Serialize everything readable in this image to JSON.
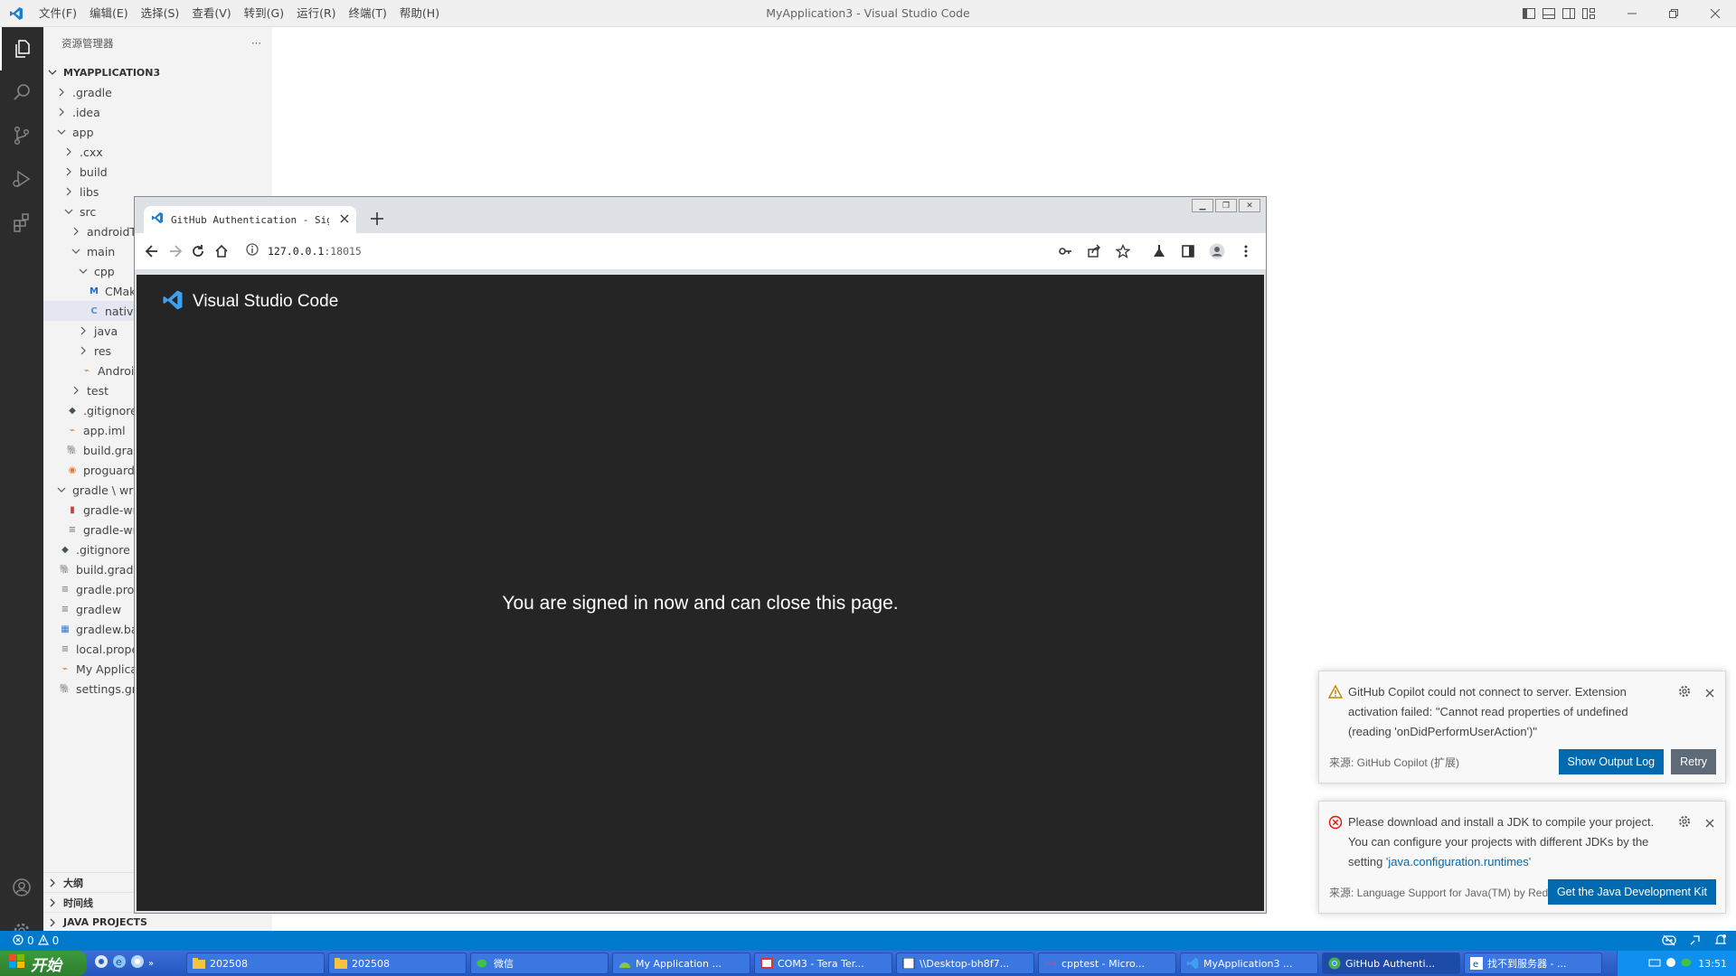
{
  "window": {
    "title": "MyApplication3 - Visual Studio Code",
    "menu": [
      "文件(F)",
      "编辑(E)",
      "选择(S)",
      "查看(V)",
      "转到(G)",
      "运行(R)",
      "终端(T)",
      "帮助(H)"
    ]
  },
  "sidebar": {
    "header": "资源管理器",
    "more_label": "···",
    "root": "MYAPPLICATION3",
    "tree": [
      {
        "label": ".gradle",
        "indent": 0,
        "kind": "folder",
        "open": false
      },
      {
        "label": ".idea",
        "indent": 0,
        "kind": "folder",
        "open": false
      },
      {
        "label": "app",
        "indent": 0,
        "kind": "folder",
        "open": true
      },
      {
        "label": ".cxx",
        "indent": 1,
        "kind": "folder",
        "open": false
      },
      {
        "label": "build",
        "indent": 1,
        "kind": "folder",
        "open": false
      },
      {
        "label": "libs",
        "indent": 1,
        "kind": "folder",
        "open": false
      },
      {
        "label": "src",
        "indent": 1,
        "kind": "folder",
        "open": true
      },
      {
        "label": "androidT",
        "indent": 2,
        "kind": "folder",
        "open": false
      },
      {
        "label": "main",
        "indent": 2,
        "kind": "folder",
        "open": true
      },
      {
        "label": "cpp",
        "indent": 3,
        "kind": "folder",
        "open": true
      },
      {
        "label": "CMak",
        "indent": 4,
        "kind": "cmake"
      },
      {
        "label": "native",
        "indent": 4,
        "kind": "cpp",
        "selected": true
      },
      {
        "label": "java",
        "indent": 3,
        "kind": "folder",
        "open": false
      },
      {
        "label": "res",
        "indent": 3,
        "kind": "folder",
        "open": false
      },
      {
        "label": "Androic",
        "indent": 3,
        "kind": "xml"
      },
      {
        "label": "test",
        "indent": 2,
        "kind": "folder",
        "open": false
      },
      {
        "label": ".gitignore",
        "indent": 1,
        "kind": "git"
      },
      {
        "label": "app.iml",
        "indent": 1,
        "kind": "xml"
      },
      {
        "label": "build.grad",
        "indent": 1,
        "kind": "gradle"
      },
      {
        "label": "proguard-",
        "indent": 1,
        "kind": "shield"
      },
      {
        "label": "gradle \\ wra",
        "indent": 0,
        "kind": "folder",
        "open": true
      },
      {
        "label": "gradle-wra",
        "indent": 1,
        "kind": "jar"
      },
      {
        "label": "gradle-wra",
        "indent": 1,
        "kind": "text"
      },
      {
        "label": ".gitignore",
        "indent": 0,
        "kind": "git"
      },
      {
        "label": "build.gradle",
        "indent": 0,
        "kind": "gradle"
      },
      {
        "label": "gradle.prop",
        "indent": 0,
        "kind": "text"
      },
      {
        "label": "gradlew",
        "indent": 0,
        "kind": "text"
      },
      {
        "label": "gradlew.bat",
        "indent": 0,
        "kind": "windows"
      },
      {
        "label": "local.proper",
        "indent": 0,
        "kind": "text"
      },
      {
        "label": "My Applica",
        "indent": 0,
        "kind": "xml"
      },
      {
        "label": "settings.gra",
        "indent": 0,
        "kind": "gradle"
      }
    ],
    "sections": [
      "大纲",
      "时间线",
      "JAVA PROJECTS"
    ]
  },
  "browser": {
    "tab_title": "GitHub Authentication - Sign",
    "url_host": "127.0.0.1",
    "url_port": ":18015",
    "brand": "Visual Studio Code",
    "message": "You are signed in now and can close this page."
  },
  "notifications": [
    {
      "type": "warning",
      "lines": [
        "GitHub Copilot could not connect to server. Extension",
        "activation failed: \"Cannot read properties of undefined",
        "(reading 'onDidPerformUserAction')\""
      ],
      "source": "来源: GitHub Copilot (扩展)",
      "primary": "Show Output Log",
      "secondary": "Retry"
    },
    {
      "type": "error",
      "line1": "Please download and install a JDK to compile your project.",
      "line2": "You can configure your projects with different JDKs by the",
      "line3_pre": "setting ",
      "line3_link": "'java.configuration.runtimes'",
      "source": "来源: Language Support for Java(TM) by Red ...",
      "primary": "Get the Java Development Kit"
    }
  ],
  "statusbar": {
    "errors": "0",
    "warnings": "0"
  },
  "taskbar": {
    "start": "开始",
    "items": [
      {
        "label": "202508",
        "icon": "folder"
      },
      {
        "label": "202508",
        "icon": "folder"
      },
      {
        "label": "微信",
        "icon": "wechat"
      },
      {
        "label": "My Application ...",
        "icon": "android"
      },
      {
        "label": "COM3 - Tera Ter...",
        "icon": "terminal"
      },
      {
        "label": "\\\\Desktop-bh8f7...",
        "icon": "notepad"
      },
      {
        "label": "cpptest - Micro...",
        "icon": "vs"
      },
      {
        "label": "MyApplication3 ...",
        "icon": "vscode"
      },
      {
        "label": "GitHub Authenti...",
        "icon": "chrome",
        "active": true
      },
      {
        "label": "找不到服务器 - ...",
        "icon": "ie"
      }
    ],
    "clock": "13:51"
  },
  "colors": {
    "accent": "#007acc",
    "activity_bar": "#2c2c2c",
    "page_bg": "#252526",
    "button_primary": "#006ab1"
  }
}
